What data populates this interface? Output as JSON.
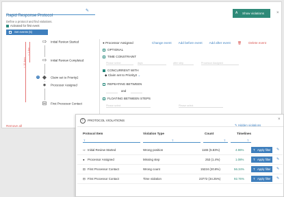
{
  "protocol": {
    "title": "Rapid Response Protocol",
    "description": "Define a protocol and find violations.",
    "activated_label": "Activated for first event",
    "set_events_label": "Set events (5)",
    "show_violations_label": "Show violations",
    "show_violations_icon": "A",
    "remove_all_label": "Remove all"
  },
  "brackets": {
    "first": "< 1 day",
    "second": "< 10 days"
  },
  "flow_nodes": [
    {
      "label": "Initial Review Started",
      "icon": "⇨"
    },
    {
      "label": "Initial Review Completed",
      "icon": "⇨"
    },
    {
      "label": "Claim set to Priority2",
      "icon": "◆"
    },
    {
      "label": "Processor Assigned",
      "icon": "●"
    },
    {
      "label": "First Processor Contact",
      "icon": "⊟"
    }
  ],
  "editor": {
    "selected_event": "Processor Assigned",
    "links": {
      "change": "Change event",
      "before": "Add before event",
      "after": "Add after event",
      "delete": "Delete event"
    },
    "options": {
      "optional": "OPTIONAL",
      "time_constraint": "TIME CONSTRAINT",
      "concurrent_with": "CONCURRENT WITH",
      "concurrent_value": "Claim set to Priority2",
      "repeating_between": "REPEATING BETWEEN",
      "and_label": "and",
      "floating_between": "FLOATING BETWEEN STEPS"
    },
    "placeholders": {
      "tc_a": "Please select",
      "tc_b": "days",
      "tc_c": "after step",
      "tc_d": "Processor Assigned",
      "fl_a": "Please select",
      "fl_b": "Please select"
    }
  },
  "violations": {
    "title": "PROTOCOL VIOLATIONS",
    "hidden_label": "Hidden violations",
    "columns": [
      "Protocol Item",
      "Violation Type",
      "Count",
      "Timelines"
    ],
    "filter_symbol": "T",
    "apply_label": "Apply filter",
    "rows": [
      {
        "item": "Initial Review Started",
        "icon": "⇨",
        "type": "Wrong position",
        "count": "1165 (5.83%)",
        "pct": "4.96%"
      },
      {
        "item": "Processor Assigned",
        "icon": "●",
        "type": "Missing step",
        "count": "253 (1.4%)",
        "pct": "1.08%"
      },
      {
        "item": "First Processor Contact",
        "icon": "⊟",
        "type": "Wrong count",
        "count": "15224 (20.8%)",
        "pct": "56.34%"
      },
      {
        "item": "First Processor Contact",
        "icon": "⊟",
        "type": "Time violation",
        "count": "23772 (34.25%)",
        "pct": "92.76%"
      }
    ]
  },
  "colors": {
    "accent": "#3f7fbd",
    "teal": "#2e8a78",
    "danger": "#d9534f"
  }
}
